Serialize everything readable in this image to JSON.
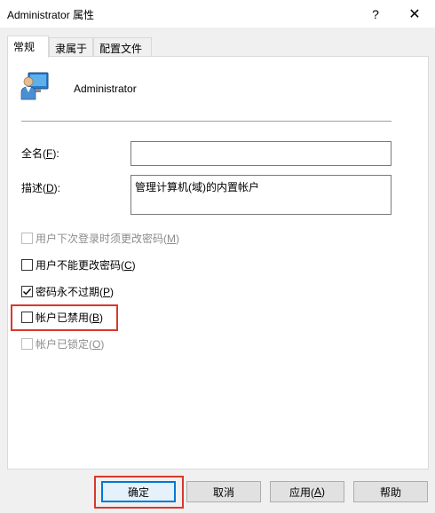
{
  "window": {
    "title": "Administrator 属性",
    "help_glyph": "?",
    "close_glyph": "✕"
  },
  "tabs": [
    {
      "label": "常规",
      "active": true
    },
    {
      "label": "隶属于",
      "active": false
    },
    {
      "label": "配置文件",
      "active": false
    }
  ],
  "general": {
    "user_name": "Administrator",
    "icon": "user-account-icon",
    "fullname": {
      "label_pre": "全名(",
      "accel": "F",
      "label_post": "):",
      "value": ""
    },
    "description": {
      "label_pre": "描述(",
      "accel": "D",
      "label_post": "):",
      "value": "管理计算机(域)的内置帐户"
    },
    "checkboxes": [
      {
        "pre": "用户下次登录时须更改密码(",
        "accel": "M",
        "post": ")",
        "checked": false,
        "enabled": false
      },
      {
        "pre": "用户不能更改密码(",
        "accel": "C",
        "post": ")",
        "checked": false,
        "enabled": true
      },
      {
        "pre": "密码永不过期(",
        "accel": "P",
        "post": ")",
        "checked": true,
        "enabled": true
      },
      {
        "pre": "帐户已禁用(",
        "accel": "B",
        "post": ")",
        "checked": false,
        "enabled": true
      },
      {
        "pre": "帐户已锁定(",
        "accel": "O",
        "post": ")",
        "checked": false,
        "enabled": false
      }
    ]
  },
  "buttons": {
    "ok": "确定",
    "cancel": "取消",
    "apply_pre": "应用(",
    "apply_accel": "A",
    "apply_post": ")",
    "help": "帮助"
  },
  "colors": {
    "highlight": "#d9382c",
    "default_button_border": "#0078d7"
  }
}
